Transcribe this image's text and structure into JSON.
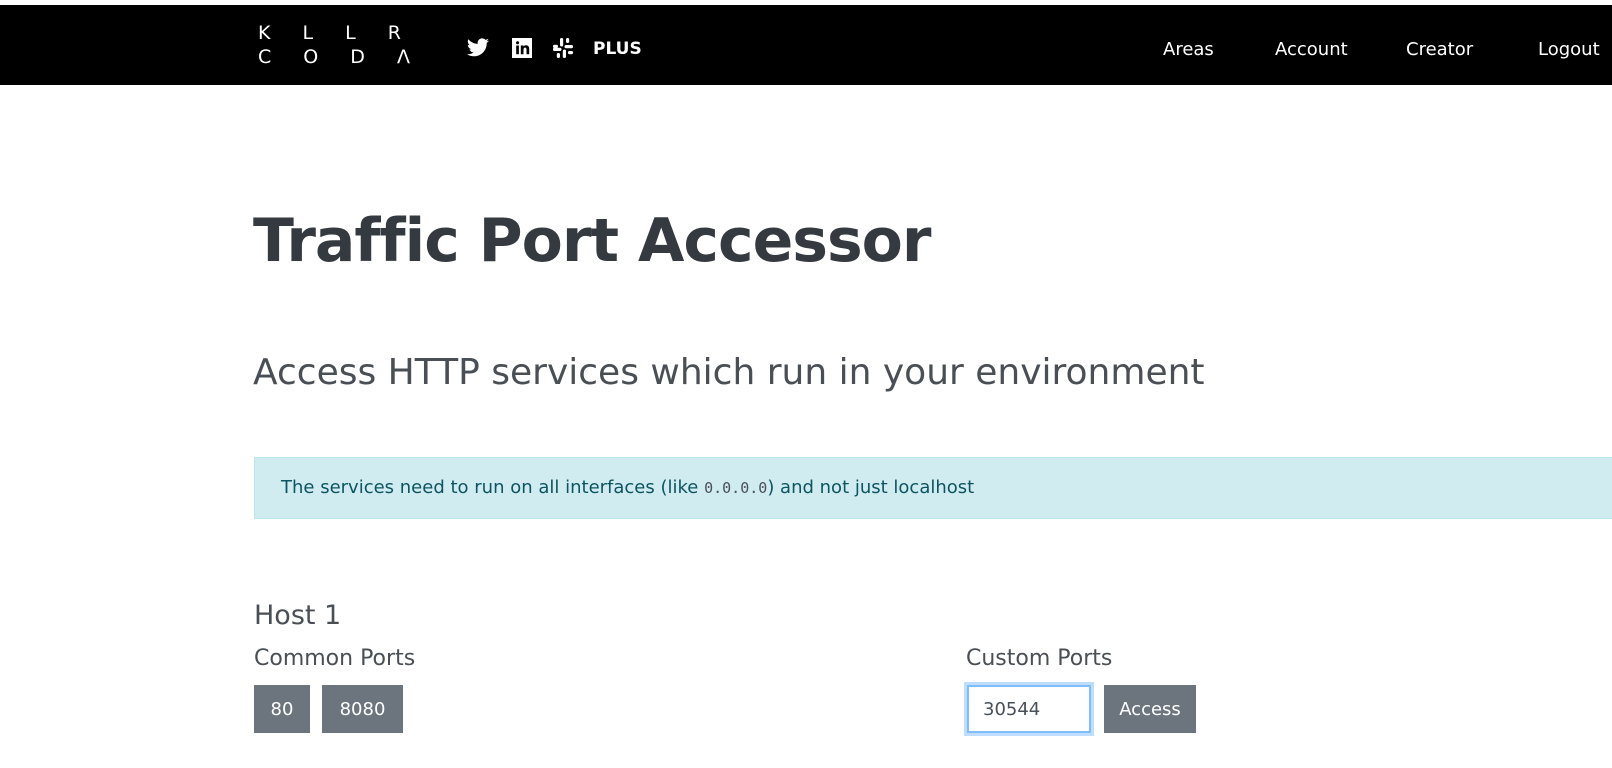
{
  "header": {
    "logo": {
      "line1": "K L L R",
      "line2": "C O D Λ"
    },
    "social": [
      {
        "icon": "twitter-icon"
      },
      {
        "icon": "linkedin-icon"
      },
      {
        "icon": "slack-icon"
      }
    ],
    "plus_label": "PLUS",
    "nav": [
      "Areas",
      "Account",
      "Creator",
      "Logout"
    ]
  },
  "main": {
    "title": "Traffic Port Accessor",
    "subtitle": "Access HTTP services which run in your environment",
    "alert": {
      "text_before": "The services need to run on all interfaces (like ",
      "code": "0.0.0.0",
      "text_after": ") and not just localhost"
    },
    "host": {
      "title": "Host 1",
      "common_ports_label": "Common Ports",
      "common_ports": [
        "80",
        "8080"
      ],
      "custom_ports_label": "Custom Ports",
      "custom_port_value": "30544",
      "access_label": "Access"
    }
  },
  "colors": {
    "header_bg": "#000000",
    "alert_bg": "#d1ecf1",
    "alert_text": "#0c5460",
    "button_bg": "#6c757d",
    "input_focus": "#80bdff"
  }
}
